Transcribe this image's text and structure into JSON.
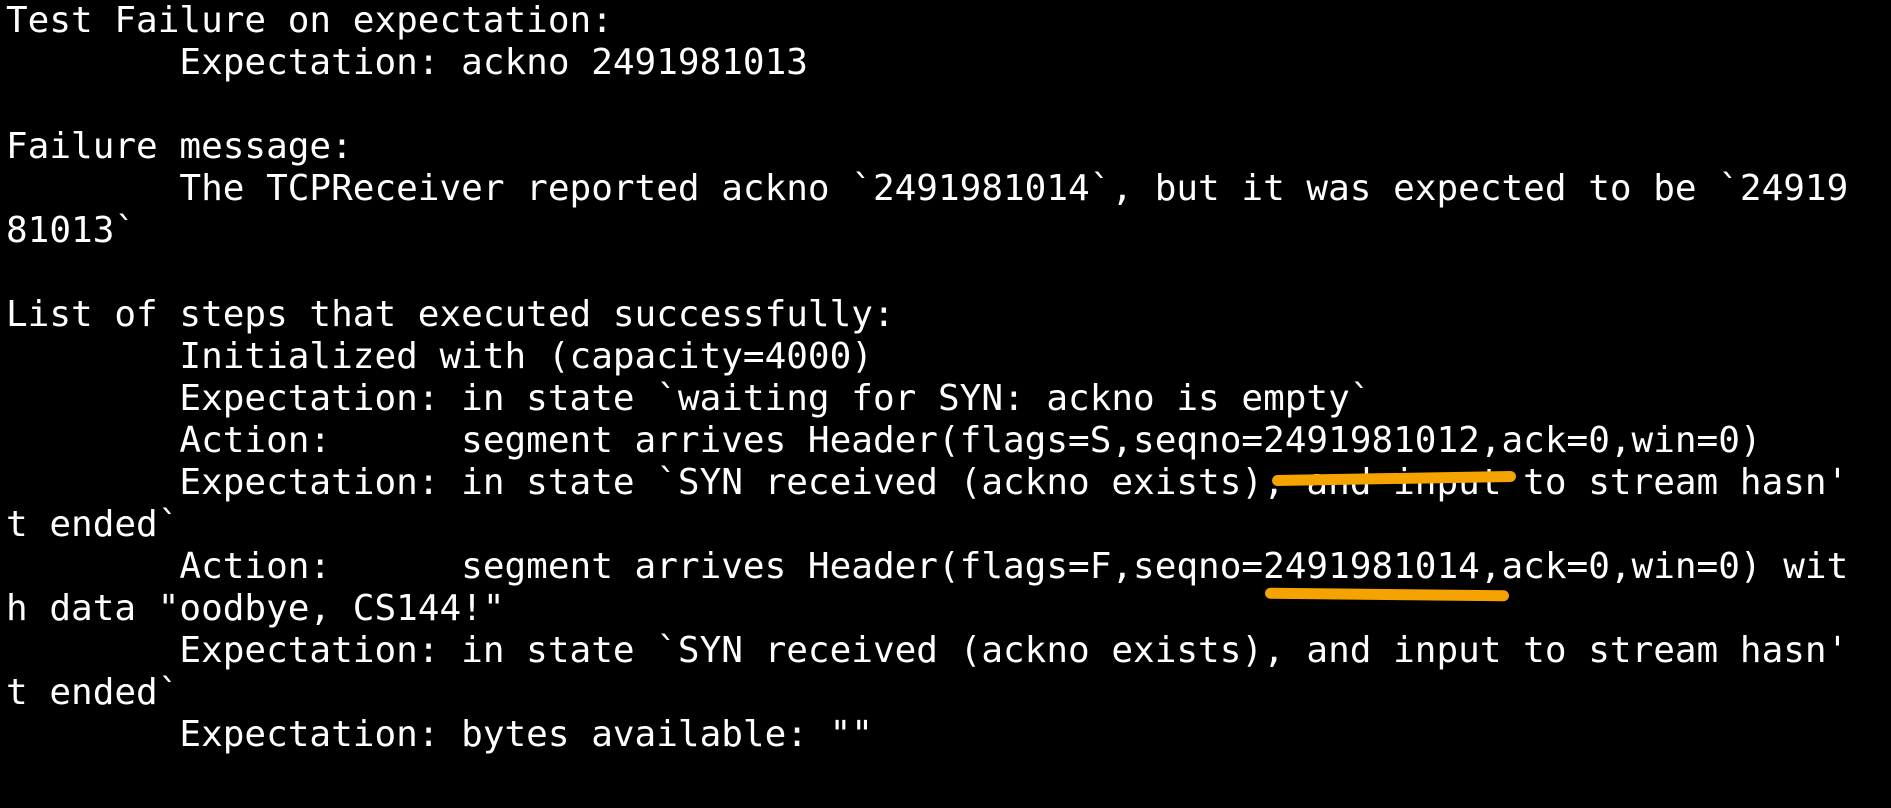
{
  "terminal": {
    "lines": [
      "Test Failure on expectation:",
      "        Expectation: ackno 2491981013",
      "",
      "Failure message:",
      "        The TCPReceiver reported ackno `2491981014`, but it was expected to be `24919",
      "81013`",
      "",
      "List of steps that executed successfully:",
      "        Initialized with (capacity=4000)",
      "        Expectation: in state `waiting for SYN: ackno is empty`",
      "        Action:      segment arrives Header(flags=S,seqno=2491981012,ack=0,win=0)",
      "        Expectation: in state `SYN received (ackno exists), and input to stream hasn'",
      "t ended`",
      "        Action:      segment arrives Header(flags=F,seqno=2491981014,ack=0,win=0) wit",
      "h data \"oodbye, CS144!\"",
      "        Expectation: in state `SYN received (ackno exists), and input to stream hasn'",
      "t ended`",
      "        Expectation: bytes available: \"\""
    ]
  },
  "colors": {
    "background": "#000000",
    "text": "#ffffff",
    "highlight": "#f5a300"
  }
}
